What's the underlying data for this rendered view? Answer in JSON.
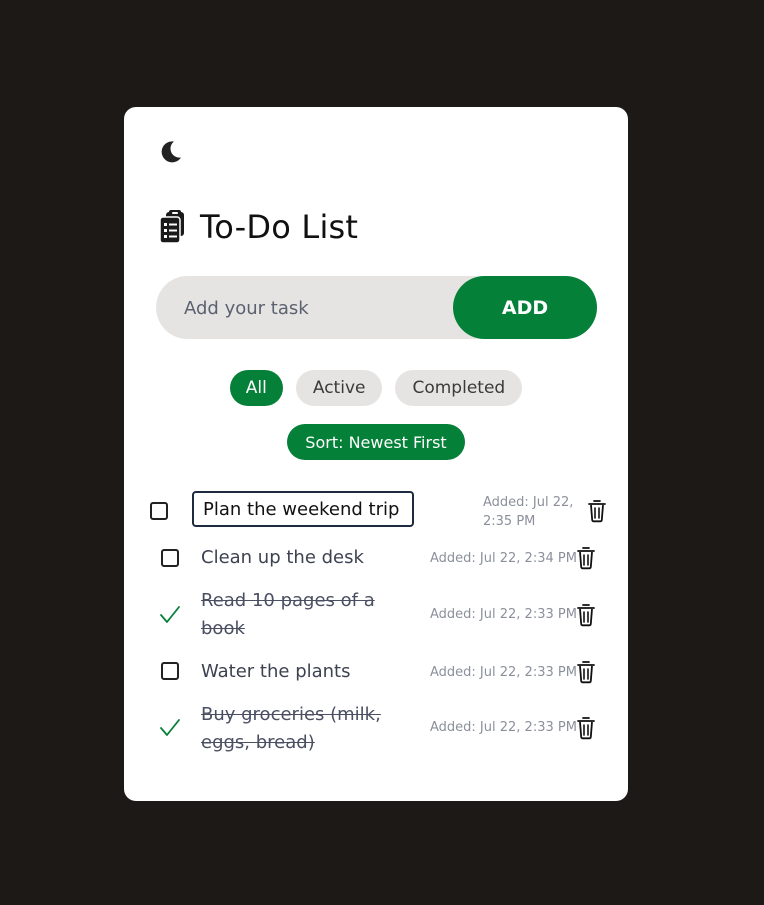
{
  "app": {
    "title": "To-Do List",
    "theme_icon": "moon-icon",
    "title_icon": "clipboard-icon"
  },
  "new_task": {
    "placeholder": "Add your task",
    "value": "",
    "add_label": "ADD"
  },
  "filters": [
    {
      "label": "All",
      "active": true
    },
    {
      "label": "Active",
      "active": false
    },
    {
      "label": "Completed",
      "active": false
    }
  ],
  "sort": {
    "label": "Sort: Newest First"
  },
  "tasks": [
    {
      "text": "Plan the weekend trip",
      "added": "Added: Jul 22, 2:35 PM",
      "completed": false,
      "editing": true
    },
    {
      "text": "Clean up the desk",
      "added": "Added: Jul 22, 2:34 PM",
      "completed": false,
      "editing": false
    },
    {
      "text": "Read 10 pages of a book",
      "added": "Added: Jul 22, 2:33 PM",
      "completed": true,
      "editing": false
    },
    {
      "text": "Water the plants",
      "added": "Added: Jul 22, 2:33 PM",
      "completed": false,
      "editing": false
    },
    {
      "text": "Buy groceries (milk, eggs, bread)",
      "added": "Added: Jul 22, 2:33 PM",
      "completed": true,
      "editing": false
    }
  ],
  "colors": {
    "accent": "#058038",
    "background": "#1d1916",
    "card": "#ffffff",
    "pill": "#e6e4e2"
  }
}
